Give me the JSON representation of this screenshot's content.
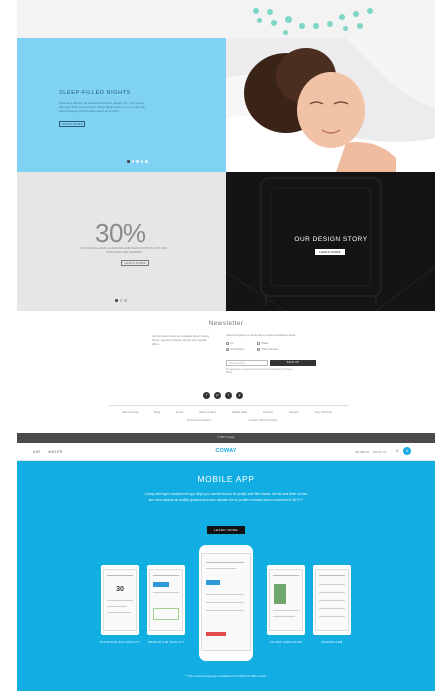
{
  "hero": {
    "sleep_title": "SLEEP-FILLED NIGHTS",
    "sleep_text": "Quiet and efficient air purifiers that won't disturb you. The Coway Airmega 400S comes with a Sleep Mode setting, so you can rest easy knowing you'll breathe clean air at night.",
    "sleep_button": "LEARN MORE",
    "stat_value": "30%",
    "stat_text": "OF PEOPLE HAVE ALLERGIES AND REACTIONS TO CAT AND DOG HAIR AND DANDER",
    "stat_button": "LEARN MORE",
    "story_title": "OUR DESIGN STORY",
    "story_button": "LEARN MORE"
  },
  "newsletter": {
    "title": "Newsletter",
    "description": "Get the latest news and updates about Coway brand, special products, service and special offers.",
    "form_text": "Select the topics you would like to receive newsletters about:",
    "options": [
      "Air",
      "Water",
      "Air Purifiers",
      "Water Purifiers"
    ],
    "email_placeholder": "Email Address",
    "signup_label": "SIGN UP",
    "fine_print": "By signing up you agree to the Terms and Conditions and Privacy Policy"
  },
  "social": [
    "f",
    "p",
    "i",
    "y"
  ],
  "footer": {
    "links": [
      "About Coway",
      "Blog",
      "Press",
      "Where to Buy",
      "Global Sites",
      "Careers",
      "Support",
      "Stay Informed"
    ],
    "links2": [
      "Terms & Conditions",
      "Cookie / Privacy Policy"
    ],
    "copyright": "© 2017 Coway"
  },
  "nav2": {
    "left": [
      "AIR",
      "WATER"
    ],
    "logo": "COWAY",
    "right": "SEARCH · SIGN IN",
    "cart_count": "0"
  },
  "app": {
    "title": "MOBILE APP",
    "text": "Coway Airmega's smartphone app helps you monitor indoor air quality and filter status, set fan and timer modes and view outdoor air quality updates and even activate the air purifier remotely when connected to Wi-Fi.**",
    "button": "LEARN MORE",
    "captions": [
      "OUTDOOR AIR QUALITY",
      "INDOOR AIR QUALITY",
      "FILTER INDICATOR",
      "SCHEDULER"
    ],
    "phone_value": "30",
    "footnote": "** The Coway Airmega app is available for the 300S and 400S models."
  },
  "colors": {
    "brand": "#1ba9e1",
    "app_bg": "#12ade3",
    "hero_blue": "#7fd2f4"
  }
}
